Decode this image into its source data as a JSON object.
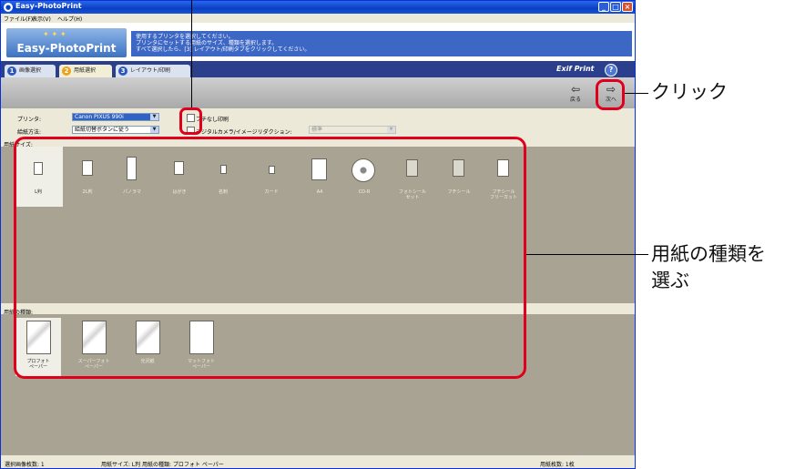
{
  "window": {
    "title": "Easy-PhotoPrint",
    "controls": [
      "_",
      "□",
      "×"
    ]
  },
  "menu": [
    "ファイル(F)",
    "表示(V)",
    "ヘルプ(H)"
  ],
  "header": {
    "logo": "Easy-PhotoPrint",
    "instructions": [
      "使用するプリンタを選択してください。",
      "プリンタにセットする用紙のサイズ、種類を選択します。",
      "すべて選択したら、[3] レイアウト/印刷タブをクリックしてください。"
    ]
  },
  "tabs": [
    {
      "num": "1",
      "label": "画像選択"
    },
    {
      "num": "2",
      "label": "用紙選択"
    },
    {
      "num": "3",
      "label": "レイアウト/印刷"
    }
  ],
  "branding": {
    "exif": "Exif Print",
    "help": "?"
  },
  "nav": {
    "back": "戻る",
    "next": "次へ"
  },
  "options": {
    "printer_label": "プリンタ:",
    "printer_value": "Canon PIXUS 990i",
    "feed_label": "給紙方法:",
    "feed_value": "給紙切替ボタンに従う",
    "borderless_label": "フチなし印刷",
    "dpof_label": "デジタルカメラ/イメージリダクション:",
    "quality_value": "標準"
  },
  "paper_size": {
    "header": "用紙サイズ:",
    "items": [
      "L判",
      "2L判",
      "パノラマ",
      "はがき",
      "名刺",
      "カード",
      "A4",
      "CD-R",
      "フォトシール\nセット",
      "フチシール",
      "フチシール\nフリーカット"
    ]
  },
  "paper_type": {
    "header": "用紙の種類:",
    "items": [
      "プロフォト\nペーパー",
      "スーパーフォト\nペーパー",
      "光沢紙",
      "マットフォト\nペーパー"
    ]
  },
  "status": {
    "left": "選択画像枚数: 1",
    "middle": "用紙サイズ: L判  用紙の種類: プロフォト ペーパー",
    "right": "用紙枚数: 1枚"
  },
  "callouts": {
    "click": "クリック",
    "choose_line1": "用紙の種類を",
    "choose_line2": "選ぶ"
  },
  "colors": {
    "accent": "#2b3f8c",
    "highlight": "#e0001b",
    "active_tab": "#e9a21e"
  }
}
